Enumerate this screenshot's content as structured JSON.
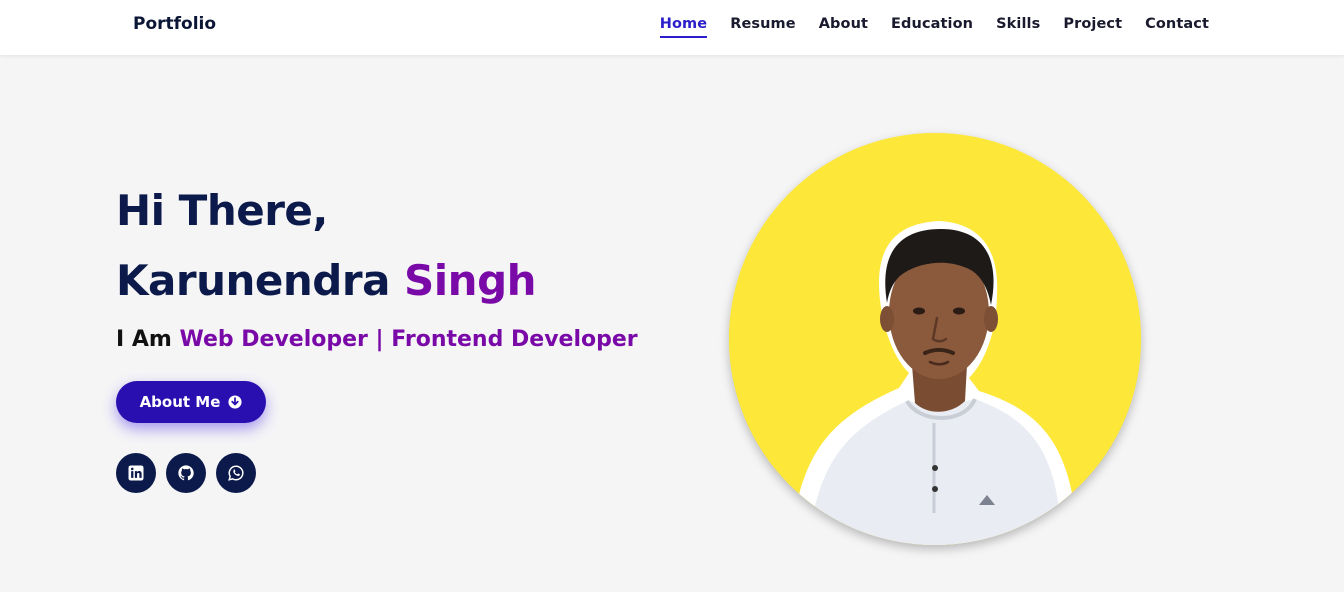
{
  "brand": "Portfolio",
  "nav": {
    "items": [
      {
        "label": "Home",
        "active": true
      },
      {
        "label": "Resume",
        "active": false
      },
      {
        "label": "About",
        "active": false
      },
      {
        "label": "Education",
        "active": false
      },
      {
        "label": "Skills",
        "active": false
      },
      {
        "label": "Project",
        "active": false
      },
      {
        "label": "Contact",
        "active": false
      }
    ]
  },
  "hero": {
    "greeting": "Hi There,",
    "first_name": "Karunendra ",
    "last_name": "Singh",
    "role_prefix": "I Am ",
    "role_text": "Web Developer | Frontend Developer",
    "button_label": "About Me",
    "button_icon": "arrow-down-circle-icon"
  },
  "socials": [
    {
      "name": "linkedin-icon"
    },
    {
      "name": "github-icon"
    },
    {
      "name": "whatsapp-icon"
    }
  ],
  "colors": {
    "accent": "#2a1fc9",
    "name_highlight": "#7a0aa8",
    "navy": "#0b1a4a",
    "button": "#2a0fb0",
    "avatar_bg": "#fde83a",
    "page_bg": "#f5f5f6"
  }
}
